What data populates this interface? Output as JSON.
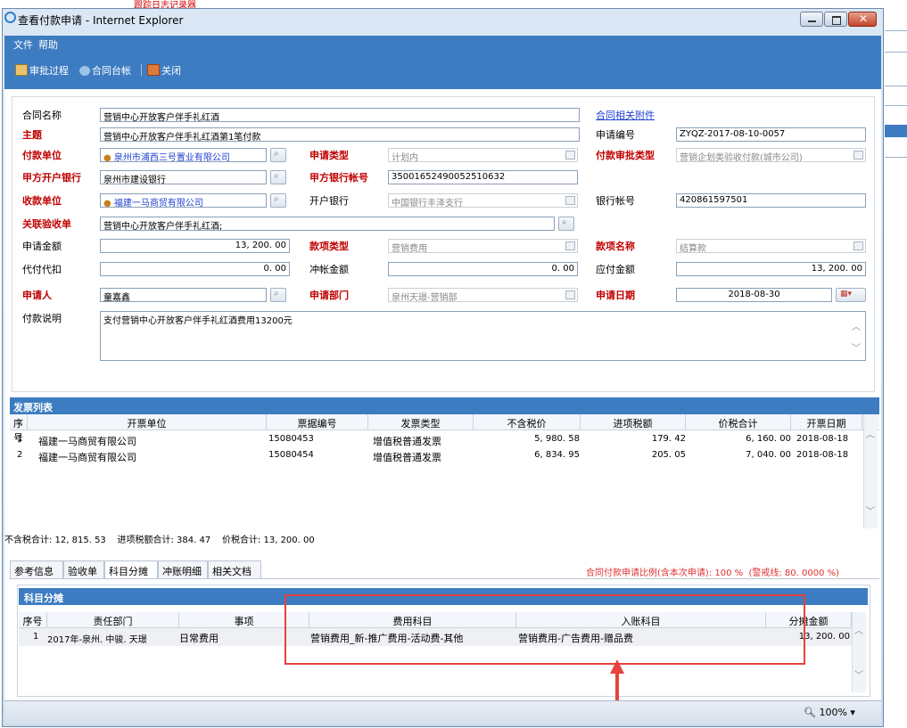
{
  "window": {
    "top_label": "跟踪日志记录器",
    "title": "查看付款申请 - Internet Explorer"
  },
  "menu": [
    "文件",
    "帮助"
  ],
  "toolbar": {
    "approval_process": "审批过程",
    "contract_ledger": "合同台帐",
    "close": "关闭"
  },
  "form": {
    "contract_name_label": "合同名称",
    "contract_name": "营销中心开放客户伴手礼红酒",
    "contract_attachment_link": "合同相关附件",
    "subject_label": "主题",
    "subject": "营销中心开放客户伴手礼红酒第1笔付款",
    "apply_no_label": "申请编号",
    "apply_no": "ZYQZ-2017-08-10-0057",
    "payer_label": "付款单位",
    "payer": "泉州市浦西三号置业有限公司",
    "apply_type_label": "申请类型",
    "apply_type": "计划内",
    "approval_type_label": "付款审批类型",
    "approval_type": "营销企划类验收付款(城市公司)",
    "payer_bank_label": "甲方开户银行",
    "payer_bank": "泉州市建设银行",
    "payer_account_label": "甲方银行帐号",
    "payer_account": "35001652490052510632",
    "payee_label": "收款单位",
    "payee": "福建一马商贸有限公司",
    "open_bank_label": "开户银行",
    "open_bank": "中国银行丰泽支行",
    "bank_account_label": "银行帐号",
    "bank_account": "420861597501",
    "acceptance_label": "关联验收单",
    "acceptance": "营销中心开放客户伴手礼红酒;",
    "apply_amount_label": "申请金额",
    "apply_amount": "13, 200. 00",
    "fund_type_label": "款项类型",
    "fund_type": "营销费用",
    "fund_name_label": "款项名称",
    "fund_name": "结算款",
    "withhold_label": "代付代扣",
    "withhold": "0. 00",
    "offset_label": "冲帐金额",
    "offset": "0. 00",
    "payable_label": "应付金额",
    "payable": "13, 200. 00",
    "applicant_label": "申请人",
    "applicant": "童嘉鑫",
    "dept_label": "申请部门",
    "dept": "泉州天璟-营销部",
    "apply_date_label": "申请日期",
    "apply_date": "2018-08-30",
    "desc_label": "付款说明",
    "desc": "支付营销中心开放客户伴手礼红酒费用13200元"
  },
  "invoice": {
    "section_title": "发票列表",
    "headers": [
      "序号",
      "开票单位",
      "票据编号",
      "发票类型",
      "不含税价",
      "进项税额",
      "价税合计",
      "开票日期"
    ],
    "rows": [
      [
        "1",
        "福建一马商贸有限公司",
        "15080453",
        "增值税普通发票",
        "5, 980. 58",
        "179. 42",
        "6, 160. 00",
        "2018-08-18"
      ],
      [
        "2",
        "福建一马商贸有限公司",
        "15080454",
        "增值税普通发票",
        "6, 834. 95",
        "205. 05",
        "7, 040. 00",
        "2018-08-18"
      ]
    ],
    "summary": "不含税合计: 12, 815. 53    进项税额合计: 384. 47    价税合计: 13, 200. 00"
  },
  "tabs": [
    "参考信息",
    "验收单",
    "科目分摊",
    "冲账明细",
    "相关文档"
  ],
  "ratio_text": "合同付款申请比例(含本次申请): 100 %  (警戒线: 80. 0000 %)",
  "allocation": {
    "section_title": "科目分摊",
    "headers": [
      "序号",
      "责任部门",
      "事项",
      "费用科目",
      "入账科目",
      "分摊金额"
    ],
    "rows": [
      [
        "1",
        "2017年-泉州. 中骏. 天璟",
        "日常费用",
        "营销费用_新-推广费用-活动费-其他",
        "营销费用-广告费用-赠品费",
        "13, 200. 00"
      ]
    ]
  },
  "status": {
    "zoom": "100%"
  }
}
